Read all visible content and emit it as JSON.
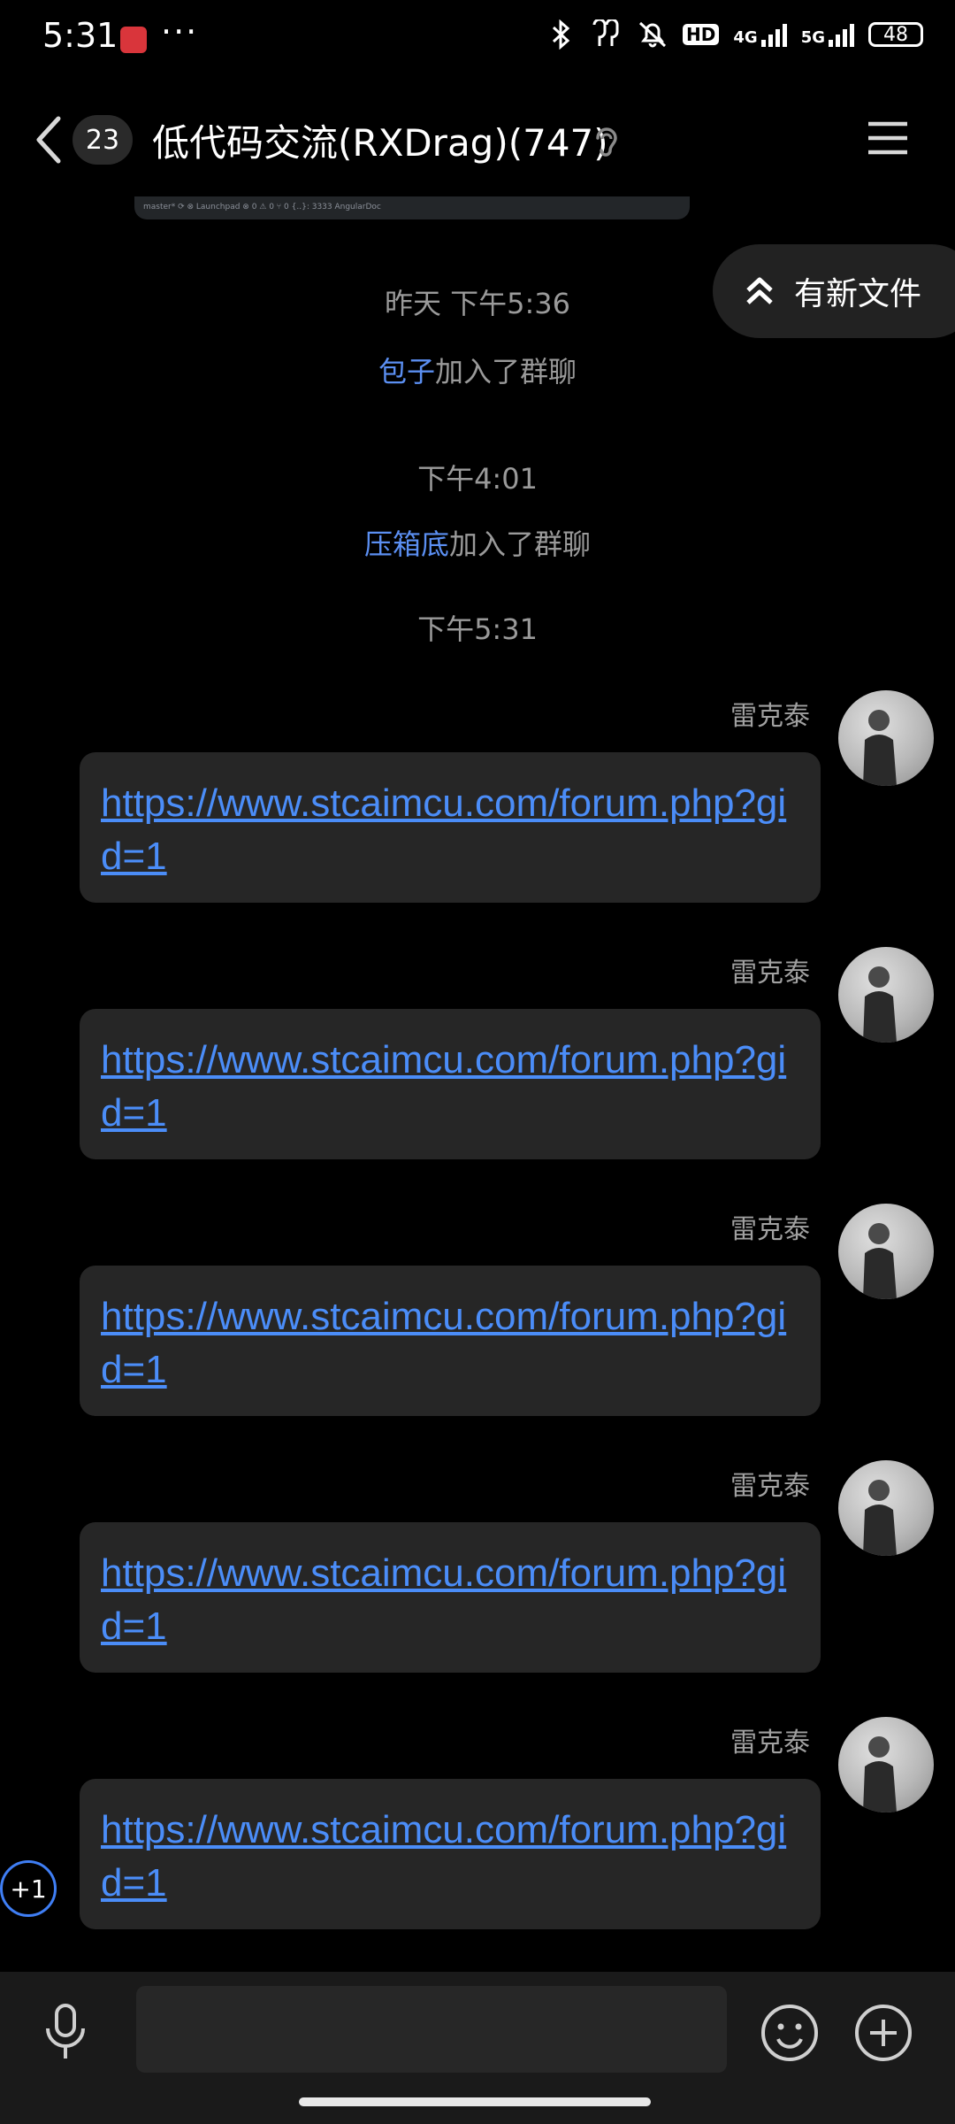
{
  "status_bar": {
    "time": "5:31",
    "dots": "···",
    "net_4g": "4G",
    "net_5g": "5G",
    "hd": "HD",
    "battery": "48"
  },
  "header": {
    "unread_count": "23",
    "title": "低代码交流(RXDrag)(747)"
  },
  "image_caption_fragment": "master*  ⟳  ⊗ Launchpad  ⊗ 0 ⚠ 0  ⑂ 0  {..}: 3333  AngularDoc",
  "new_file_pill": "有新文件",
  "timeline": {
    "ts1": "昨天 下午5:36",
    "join1_name": "包子",
    "join1_suffix": "加入了群聊",
    "ts2": "下午4:01",
    "join2_name": "压箱底",
    "join2_suffix": "加入了群聊",
    "ts3": "下午5:31"
  },
  "messages": [
    {
      "sender": "雷克泰",
      "link": "https://www.stcaimcu.com/forum.php?gid=1"
    },
    {
      "sender": "雷克泰",
      "link": "https://www.stcaimcu.com/forum.php?gid=1"
    },
    {
      "sender": "雷克泰",
      "link": "https://www.stcaimcu.com/forum.php?gid=1"
    },
    {
      "sender": "雷克泰",
      "link": "https://www.stcaimcu.com/forum.php?gid=1"
    },
    {
      "sender": "雷克泰",
      "link": "https://www.stcaimcu.com/forum.php?gid=1"
    }
  ],
  "plus_one": "+1",
  "input": {
    "value": "",
    "placeholder": ""
  },
  "colors": {
    "link": "#4b8df8",
    "system_name": "#5b8ff2",
    "accent_ring": "#3f7ef4"
  },
  "icons": [
    "back-chevron-icon",
    "ear-icon",
    "menu-icon",
    "double-chevron-up-icon",
    "mic-icon",
    "emoji-icon",
    "plus-icon",
    "bluetooth-icon",
    "earbuds-icon",
    "mute-bell-icon"
  ]
}
